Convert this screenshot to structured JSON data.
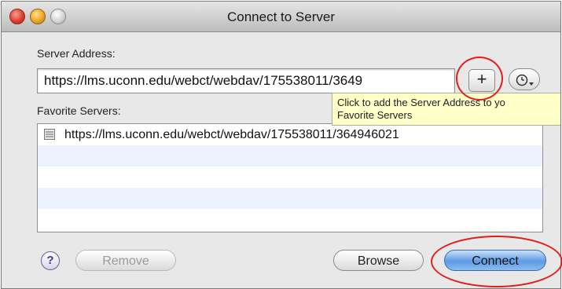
{
  "window": {
    "title": "Connect to Server"
  },
  "form": {
    "server_address_label": "Server Address:",
    "server_address_value": "https://lms.uconn.edu/webct/webdav/175538011/3649",
    "add_button_label": "+",
    "favorites_label": "Favorite Servers:"
  },
  "tooltip": {
    "line1": "Click to add the Server Address to yo",
    "line2": "Favorite Servers"
  },
  "favorites": [
    {
      "url": "https://lms.uconn.edu/webct/webdav/175538011/364946021"
    }
  ],
  "buttons": {
    "help_label": "?",
    "remove_label": "Remove",
    "browse_label": "Browse",
    "connect_label": "Connect"
  },
  "icons": {
    "close": "close-traffic-light-icon",
    "minimize": "minimize-traffic-light-icon",
    "zoom": "zoom-traffic-light-icon",
    "history": "clock-history-icon",
    "server": "server-icon",
    "help": "help-icon"
  },
  "colors": {
    "highlight_circle": "#e01e1e",
    "tooltip_bg": "#ffffc8",
    "list_alt_row": "#edf3fe",
    "connect_button": "#5d9be3"
  }
}
